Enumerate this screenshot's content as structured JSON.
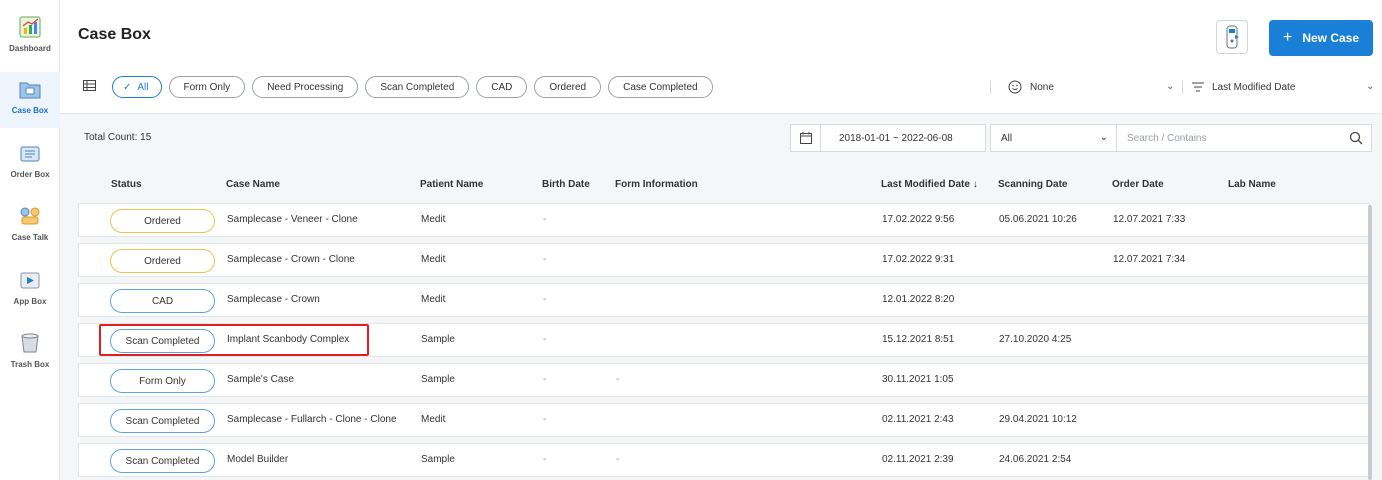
{
  "sidebar": {
    "items": [
      {
        "label": "Dashboard"
      },
      {
        "label": "Case Box"
      },
      {
        "label": "Order Box"
      },
      {
        "label": "Case Talk"
      },
      {
        "label": "App Box"
      },
      {
        "label": "Trash Box"
      }
    ]
  },
  "header": {
    "title": "Case Box",
    "new_case_label": "New Case",
    "new_case_plus": "+"
  },
  "filters": {
    "chips": [
      "All",
      "Form Only",
      "Need Processing",
      "Scan Completed",
      "CAD",
      "Ordered",
      "Case Completed"
    ],
    "active_chip": "All",
    "none_filter": "None",
    "sort_label": "Last Modified Date"
  },
  "toolbar": {
    "total_count": "Total Count: 15",
    "date_range": "2018-01-01 ~ 2022-06-08",
    "select_value": "All",
    "search_placeholder": "Search / Contains"
  },
  "table": {
    "headers": {
      "status": "Status",
      "case_name": "Case Name",
      "patient_name": "Patient Name",
      "birth_date": "Birth Date",
      "form_information": "Form Information",
      "last_modified": "Last Modified Date",
      "sort_arrow": "↓",
      "scanning_date": "Scanning Date",
      "order_date": "Order Date",
      "lab_name": "Lab Name"
    },
    "rows": [
      {
        "status": "Ordered",
        "case_name": "Samplecase - Veneer - Clone",
        "patient": "Medit",
        "birth": "-",
        "form": "",
        "modified": "17.02.2022 9:56",
        "scanning": "05.06.2021 10:26",
        "order": "12.07.2021 7:33",
        "lab": ""
      },
      {
        "status": "Ordered",
        "case_name": "Samplecase - Crown - Clone",
        "patient": "Medit",
        "birth": "-",
        "form": "",
        "modified": "17.02.2022 9:31",
        "scanning": "",
        "order": "12.07.2021 7:34",
        "lab": ""
      },
      {
        "status": "CAD",
        "case_name": "Samplecase - Crown",
        "patient": "Medit",
        "birth": "-",
        "form": "",
        "modified": "12.01.2022 8:20",
        "scanning": "",
        "order": "",
        "lab": ""
      },
      {
        "status": "Scan Completed",
        "case_name": "Implant Scanbody Complex",
        "patient": "Sample",
        "birth": "-",
        "form": "",
        "modified": "15.12.2021 8:51",
        "scanning": "27.10.2020 4:25",
        "order": "",
        "lab": ""
      },
      {
        "status": "Form Only",
        "case_name": "Sample's Case",
        "patient": "Sample",
        "birth": "-",
        "form": "-",
        "modified": "30.11.2021 1:05",
        "scanning": "",
        "order": "",
        "lab": ""
      },
      {
        "status": "Scan Completed",
        "case_name": "Samplecase - Fullarch - Clone - Clone",
        "patient": "Medit",
        "birth": "-",
        "form": "",
        "modified": "02.11.2021 2:43",
        "scanning": "29.04.2021 10:12",
        "order": "",
        "lab": ""
      },
      {
        "status": "Scan Completed",
        "case_name": "Model Builder",
        "patient": "Sample",
        "birth": "-",
        "form": "-",
        "modified": "02.11.2021 2:39",
        "scanning": "24.06.2021 2:54",
        "order": "",
        "lab": ""
      }
    ]
  },
  "colors": {
    "accent": "#1a7fd6",
    "ordered_border": "#f2c14e",
    "status_border": "#5ba3e2",
    "highlight": "#e02020"
  }
}
